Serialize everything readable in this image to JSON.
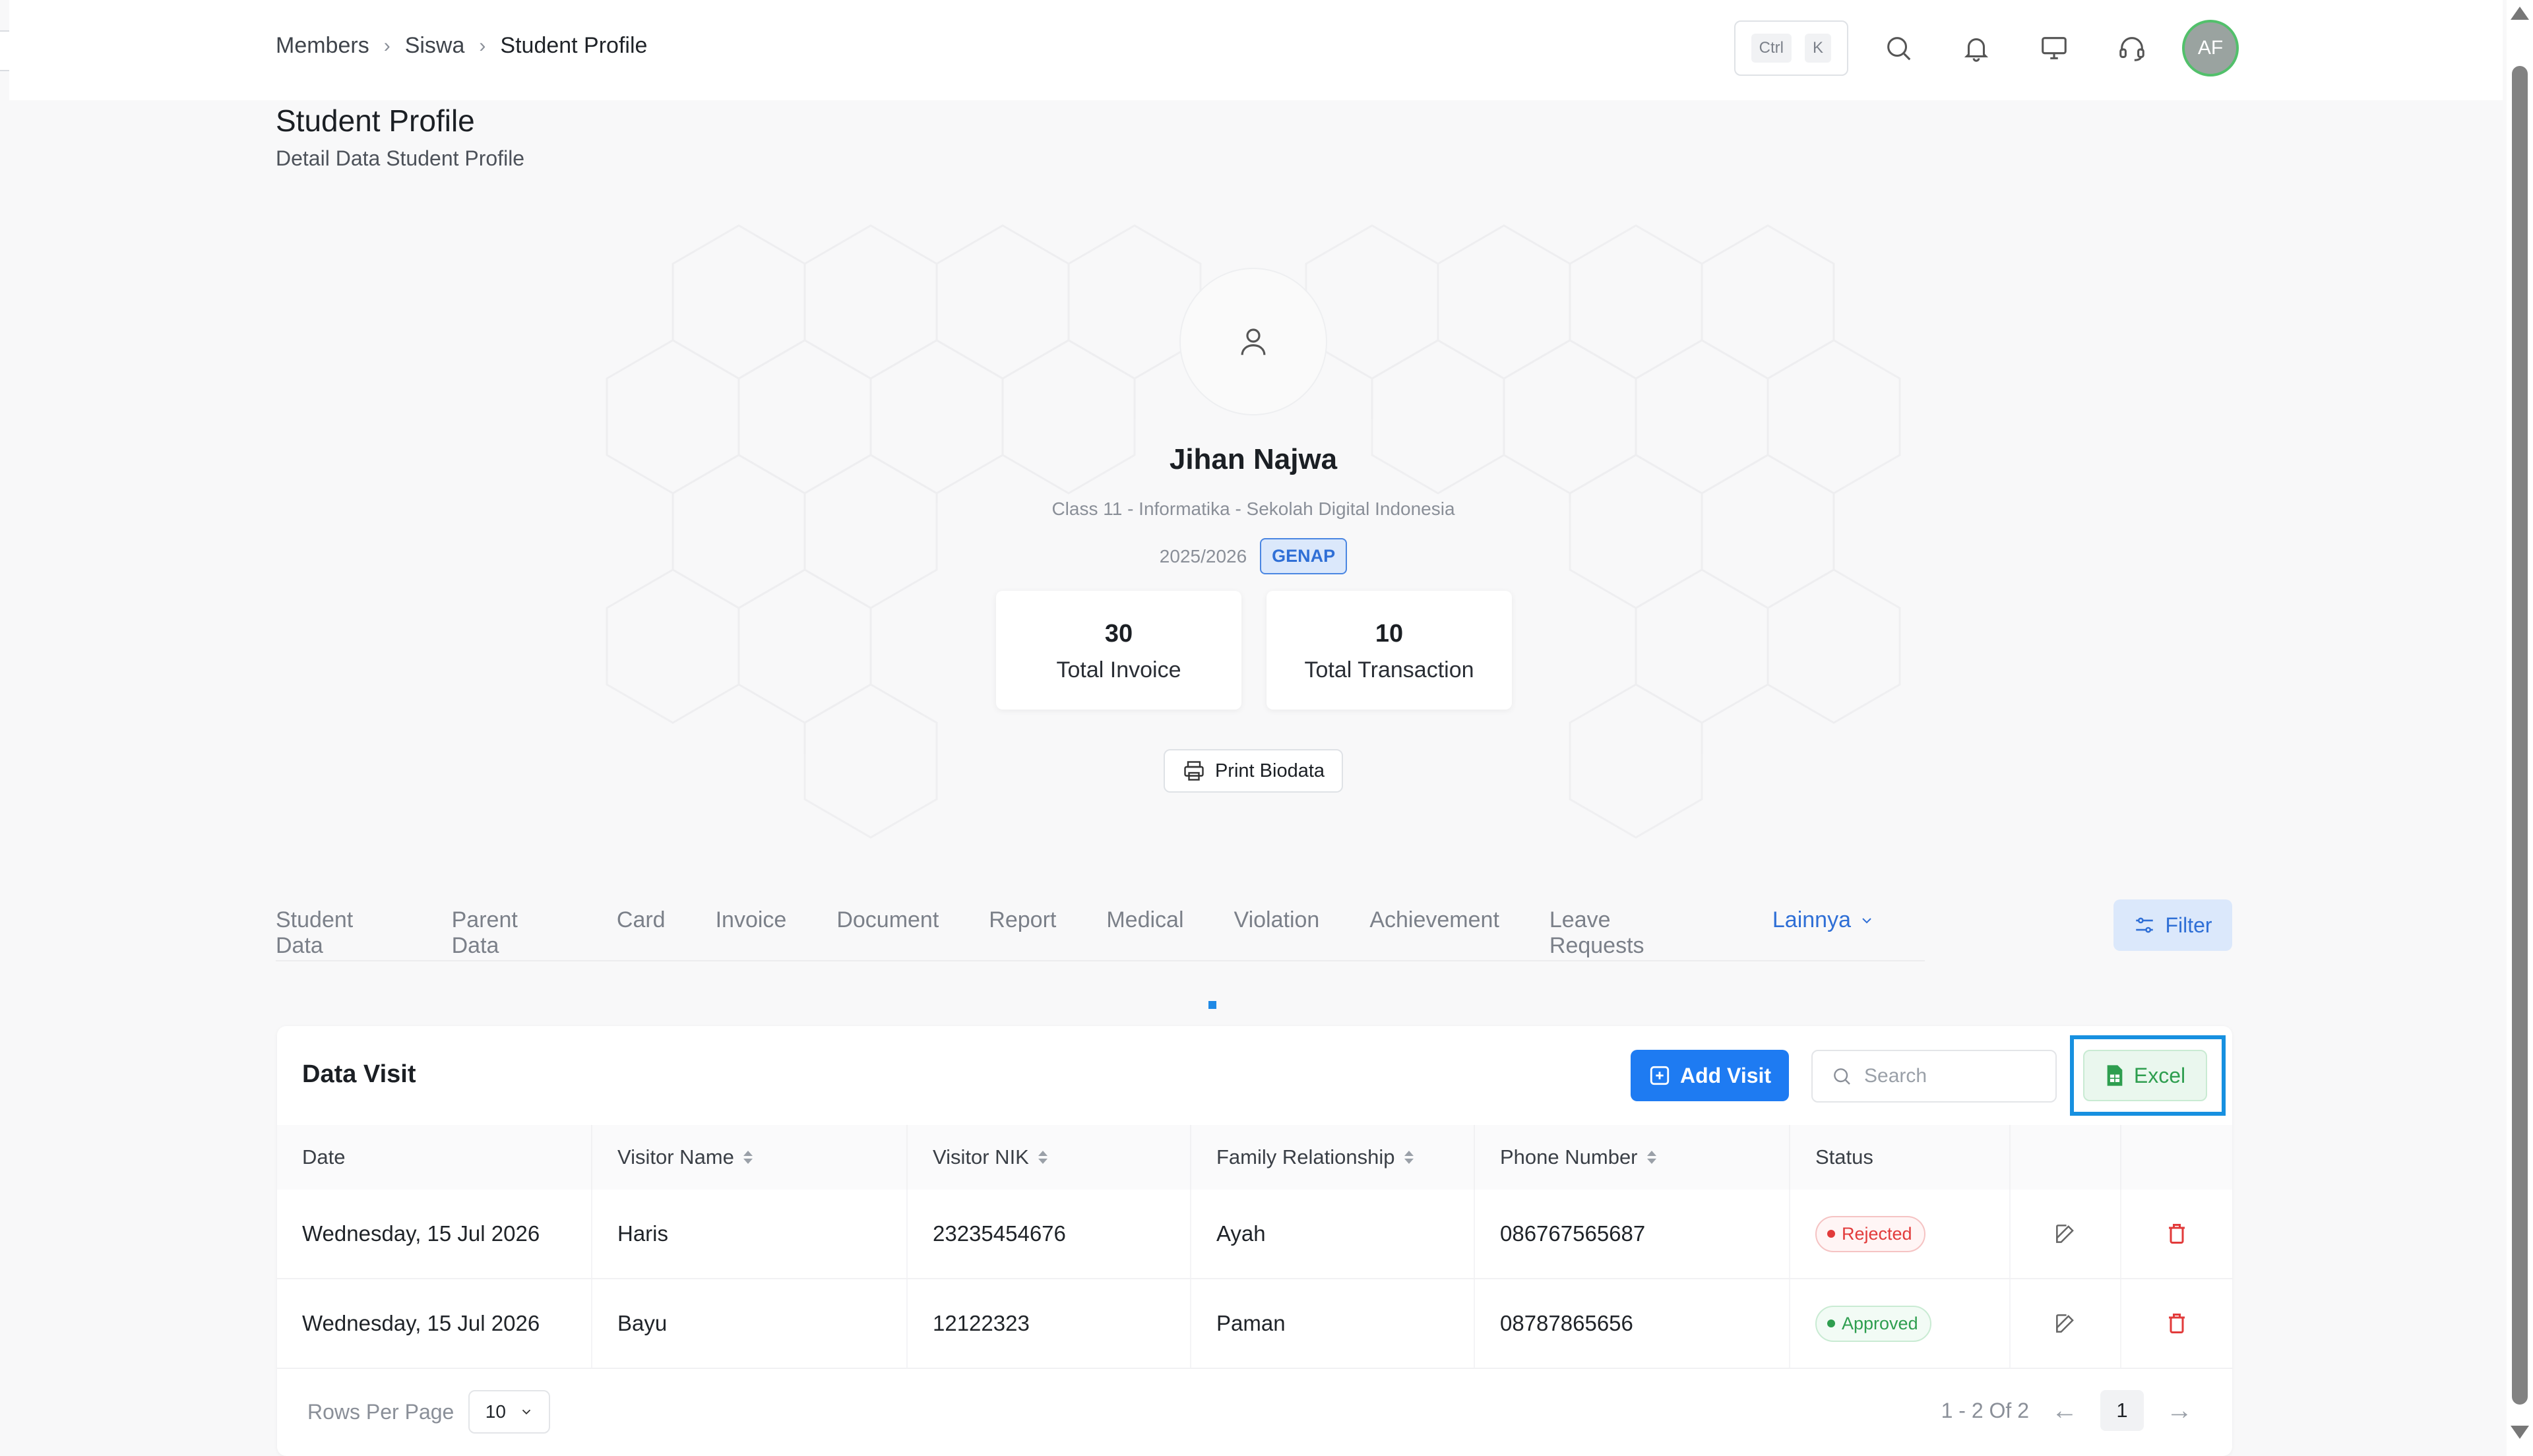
{
  "sidebar_toggle": {
    "label": "K"
  },
  "breadcrumb": {
    "items": [
      "Members",
      "Siswa",
      "Student Profile"
    ],
    "separator": "›"
  },
  "topbar": {
    "kbd_1": "Ctrl",
    "kbd_2": "K",
    "avatar_initials": "AF"
  },
  "page": {
    "title": "Student Profile",
    "subtitle": "Detail Data Student Profile"
  },
  "profile": {
    "name": "Jihan Najwa",
    "class_line": "Class 11 - Informatika - Sekolah Digital Indonesia",
    "year": "2025/2026",
    "semester": "GENAP",
    "stats": [
      {
        "value": "30",
        "label": "Total Invoice"
      },
      {
        "value": "10",
        "label": "Total Transaction"
      }
    ],
    "print_label": "Print Biodata"
  },
  "tabs": {
    "items": [
      "Student Data",
      "Parent Data",
      "Card",
      "Invoice",
      "Document",
      "Report",
      "Medical",
      "Violation",
      "Achievement",
      "Leave Requests"
    ],
    "more_label": "Lainnya",
    "filter_label": "Filter"
  },
  "visit_card": {
    "title": "Data Visit",
    "add_label": "Add Visit",
    "search_placeholder": "Search",
    "excel_label": "Excel",
    "columns": [
      "Date",
      "Visitor Name",
      "Visitor NIK",
      "Family Relationship",
      "Phone Number",
      "Status"
    ],
    "rows": [
      {
        "date": "Wednesday, 15 Jul 2026",
        "name": "Haris",
        "nik": "23235454676",
        "relationship": "Ayah",
        "phone": "086767565687",
        "status": "Rejected"
      },
      {
        "date": "Wednesday, 15 Jul 2026",
        "name": "Bayu",
        "nik": "12122323",
        "relationship": "Paman",
        "phone": "08787865656",
        "status": "Approved"
      }
    ],
    "pagination": {
      "rows_label": "Rows Per Page",
      "rows_value": "10",
      "range": "1 - 2 Of 2",
      "prev": "←",
      "next": "→",
      "current_page": "1"
    }
  },
  "colors": {
    "primary": "#1e7bf2",
    "excel_green": "#2e9e4f",
    "rejected_red": "#e23b3b",
    "highlight_blue": "#1790e0"
  },
  "icons": [
    "search-icon",
    "bell-icon",
    "monitor-icon",
    "headset-icon",
    "user-icon",
    "printer-icon",
    "filter-icon",
    "plus-square-icon",
    "spreadsheet-icon",
    "edit-icon",
    "trash-icon",
    "chevron-down-icon"
  ]
}
